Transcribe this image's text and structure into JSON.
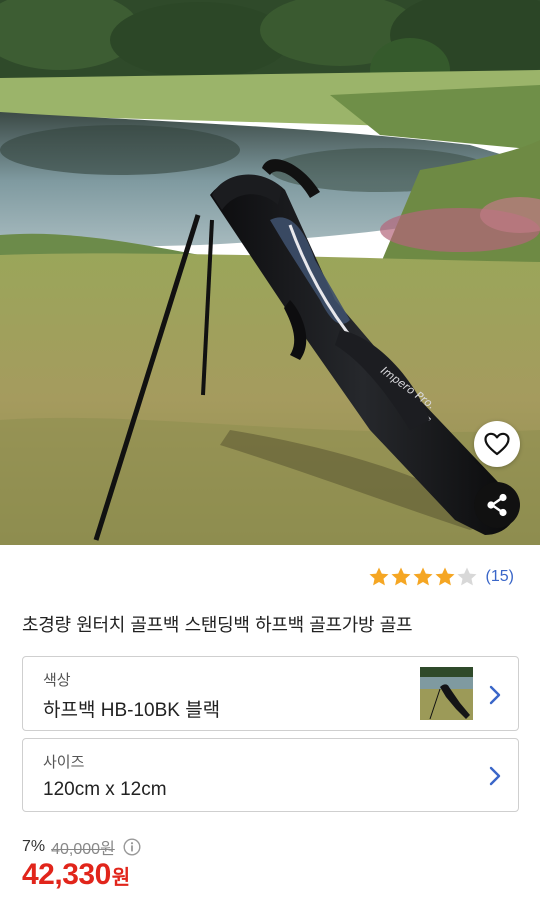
{
  "product": {
    "title": "초경량 원터치 골프백 스탠딩백 하프백 골프가방 골프",
    "image_alt_icon": "golf-bag-photo"
  },
  "rating": {
    "stars": 4,
    "max_stars": 5,
    "count": "(15)",
    "star_color": "#f5a623",
    "empty_star_color": "#d8d8d8",
    "count_color": "#3a66c8"
  },
  "options": {
    "color": {
      "label": "색상",
      "value": "하프백 HB-10BK 블랙"
    },
    "size": {
      "label": "사이즈",
      "value": "120cm x 12cm"
    }
  },
  "price": {
    "discount": "7%",
    "original": "40,000원",
    "sale": "42,330",
    "currency": "원",
    "sale_color": "#e1251b"
  },
  "icons": {
    "wishlist": "heart-outline-icon",
    "share": "share-icon",
    "info": "info-icon",
    "chevron": "chevron-right-icon"
  }
}
